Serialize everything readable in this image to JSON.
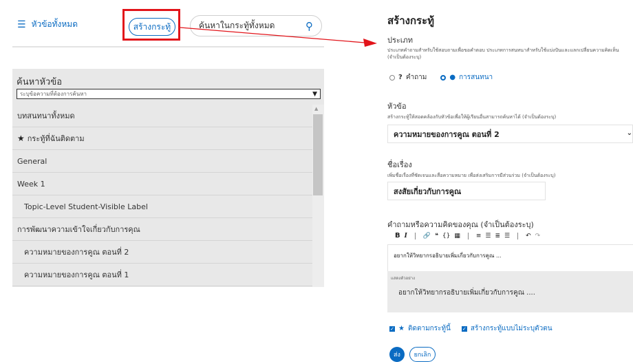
{
  "left_header": {
    "all_topics_label": "หัวข้อทั้งหมด",
    "create_post_label": "สร้างกระทู้",
    "search_placeholder": "ค้นหาในกระทู้ทั้งหมด"
  },
  "topic_panel": {
    "title": "ค้นหาหัวข้อ",
    "filter_placeholder": "ระบุข้อความที่ต้องการค้นหา",
    "items": [
      {
        "label": "บทสนทนาทั้งหมด"
      },
      {
        "label": "กระทู้ที่ฉันติดตาม"
      },
      {
        "label": "General"
      },
      {
        "label": "Week 1"
      },
      {
        "label": "Topic-Level Student-Visible Label"
      },
      {
        "label": "การพัฒนาความเข้าใจเกี่ยวกับการคุณ"
      },
      {
        "label": "ความหมายของการคูณ ตอนที่ 2"
      },
      {
        "label": "ความหมายของการคูณ ตอนที่ 1"
      }
    ]
  },
  "form": {
    "title": "สร้างกระทู้",
    "type_label": "ประเภท",
    "type_help": "ประเภทคำถามสำหรับใช้สอบถามเพื่อขอคำตอบ ประเภทการสนทนาสำหรับใช้แบ่งปันและแลกเปลี่ยนความคิดเห็น (จำเป็นต้องระบุ)",
    "option_question": "คำถาม",
    "option_discussion": "การสนทนา",
    "topic_label": "หัวข้อ",
    "topic_help": "สร้างกระทู้ให้สอดคล้องกับหัวข้อเพื่อให้ผู้เรียนอื่นสามารถค้นหาได้ (จำเป็นต้องระบุ)",
    "topic_value": "ความหมายของการคูณ ตอนที่ 2",
    "subject_label": "ชื่อเรื่อง",
    "subject_help": "เพิ่มชื่อเรื่องที่ชัดเจนและสื่อความหมาย เพื่อส่งเสริมการมีส่วนร่วม (จำเป็นต้องระบุ)",
    "subject_value": "สงสัยเกี่ยวกับการคูณ",
    "body_label": "คำถามหรือความคิดของคุณ (จำเป็นต้องระบุ)",
    "body_value": "อยากให้วิทยากรอธิบายเพิ่มเกี่ยวกับการคูณ ...",
    "preview_label": "แสดงตัวอย่าง",
    "preview_text": "อยากให้วิทยากรอธิบายเพิ่มเกี่ยวกับการคูณ ....",
    "follow_label": "ติดตามกระทู้นี้",
    "anonymous_label": "สร้างกระทู้แบบไม่ระบุตัวตน",
    "submit_label": "ส่ง",
    "cancel_label": "ยกเลิก"
  },
  "colors": {
    "accent": "#0a6bc2",
    "annotation": "#e2141a",
    "panel_bg": "#e8e8e8"
  }
}
